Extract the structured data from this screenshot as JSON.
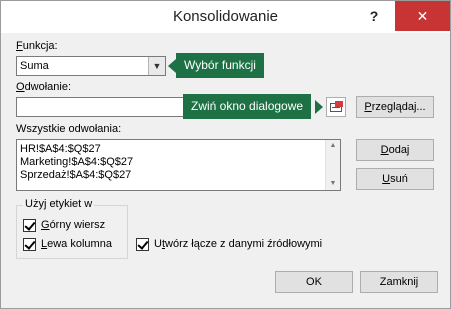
{
  "window": {
    "title": "Konsolidowanie",
    "help_label": "?",
    "close_label": "✕"
  },
  "function": {
    "label": "Funkcja:",
    "label_hotkey": "F",
    "label_rest": "unkcja:",
    "value": "Suma"
  },
  "callouts": {
    "function_hint": "Wybór funkcji",
    "collapse_hint": "Zwiń okno dialogowe"
  },
  "reference": {
    "label_hotkey": "O",
    "label_rest": "dwołanie:",
    "value": "",
    "browse_hotkey": "P",
    "browse_rest": "rzeglądaj..."
  },
  "all_references": {
    "label": "Wszystkie odwołania:",
    "items": [
      "HR!$A$4:$Q$27",
      "Marketing!$A$4:$Q$27",
      "Sprzedaż!$A$4:$Q$27"
    ]
  },
  "buttons": {
    "add_hotkey": "D",
    "add_rest": "odaj",
    "delete_hotkey": "U",
    "delete_rest": "suń",
    "ok": "OK",
    "close": "Zamknij"
  },
  "labels_group": {
    "title": "Użyj etykiet w",
    "top_row_hotkey": "G",
    "top_row_rest": "órny wiersz",
    "left_column_hotkey": "L",
    "left_column_rest": "ewa kolumna",
    "top_row_checked": true,
    "left_column_checked": true
  },
  "links": {
    "hotkey": "t",
    "before": "U",
    "after": "wórz łącze z danymi źródłowymi",
    "checked": true
  },
  "colors": {
    "callout_bg": "#1e7145",
    "close_hover": "#c83434"
  }
}
